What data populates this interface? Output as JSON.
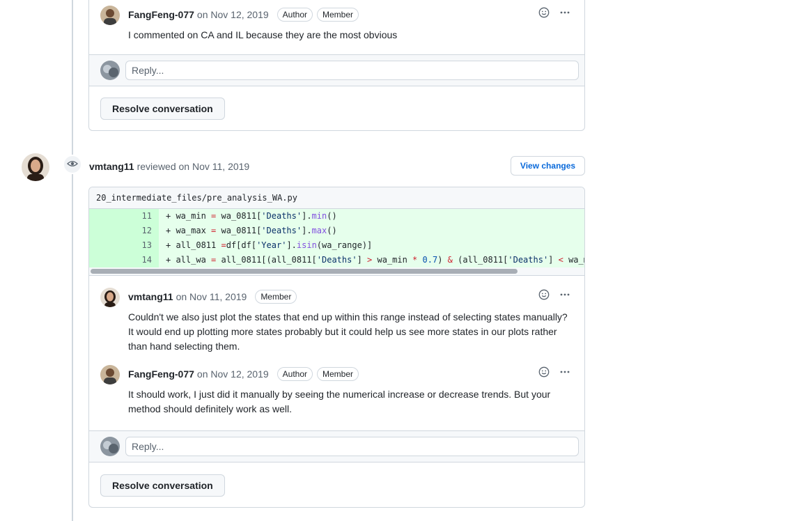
{
  "thread1": {
    "comment": {
      "author": "FangFeng-077",
      "date": "on Nov 12, 2019",
      "labels": [
        "Author",
        "Member"
      ],
      "body": "I commented on CA and IL because they are the most obvious"
    },
    "reply_placeholder": "Reply...",
    "resolve_label": "Resolve conversation"
  },
  "review": {
    "reviewer": "vmtang11",
    "action_text": "reviewed on Nov 11, 2019",
    "view_changes_label": "View changes",
    "file_path": "20_intermediate_files/pre_analysis_WA.py",
    "code_lines": [
      {
        "num": "11",
        "text": "+ wa_min = wa_0811['Deaths'].min()"
      },
      {
        "num": "12",
        "text": "+ wa_max = wa_0811['Deaths'].max()"
      },
      {
        "num": "13",
        "text": "+ all_0811 =df[df['Year'].isin(wa_range)]"
      },
      {
        "num": "14",
        "text": "+ all_wa = all_0811[(all_0811['Deaths'] > wa_min * 0.7) & (all_0811['Deaths'] < wa_m"
      }
    ],
    "comments": [
      {
        "author": "vmtang11",
        "date": "on Nov 11, 2019",
        "labels": [
          "Member"
        ],
        "body": "Couldn't we also just plot the states that end up within this range instead of selecting states manually? It would end up plotting more states probably but it could help us see more states in our plots rather than hand selecting them."
      },
      {
        "author": "FangFeng-077",
        "date": "on Nov 12, 2019",
        "labels": [
          "Author",
          "Member"
        ],
        "body": "It should work, I just did it manually by seeing the numerical increase or decrease trends. But your method should definitely work as well."
      }
    ],
    "reply_placeholder": "Reply...",
    "resolve_label": "Resolve conversation"
  },
  "icons": {
    "reaction": "smiley-icon",
    "more": "kebab-horizontal-icon",
    "review": "eye-icon"
  },
  "colors": {
    "link": "#0969da",
    "addition_bg": "#e6ffec",
    "addition_num_bg": "#ccffd8",
    "border": "#d0d7de",
    "muted": "#59636e"
  }
}
